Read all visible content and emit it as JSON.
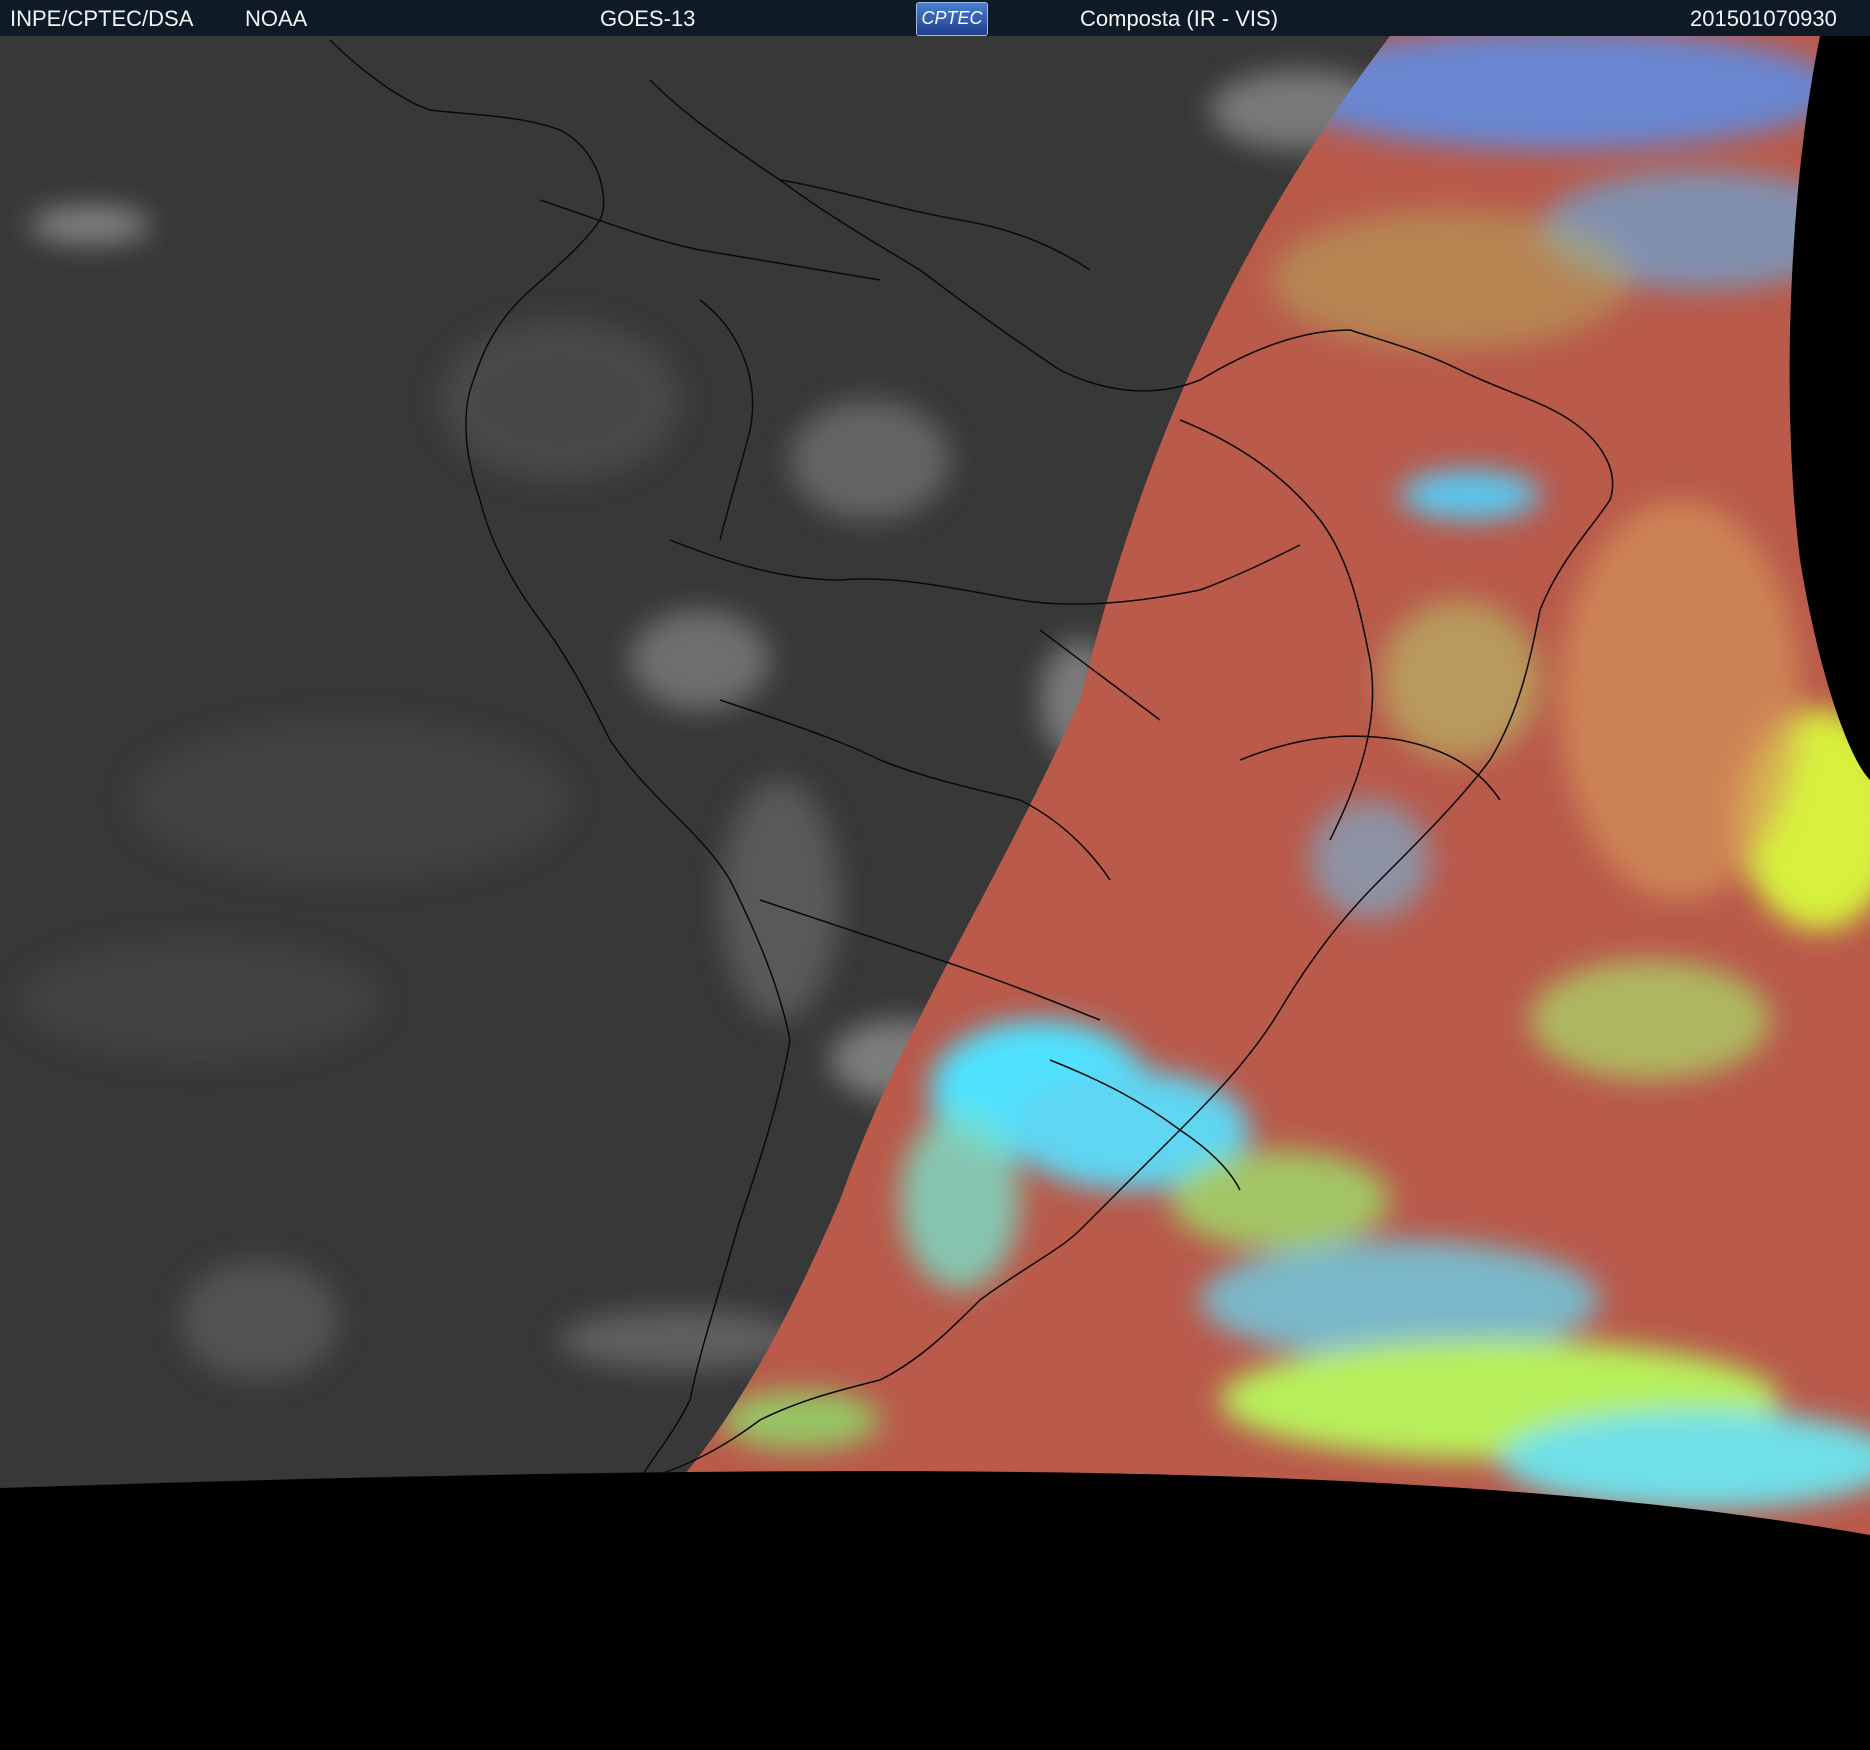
{
  "header": {
    "agency": "INPE/CPTEC/DSA",
    "partner": "NOAA",
    "satellite": "GOES-13",
    "logo_text": "CPTEC",
    "product": "Composta (IR - VIS)",
    "timestamp": "201501070930"
  },
  "colors": {
    "night_gray": "#3a3a3a",
    "day_red": "#b85a4c",
    "cloud_cyan": "#46d6ff",
    "cloud_green": "#a8ef5a",
    "header_bg": "#0e1b26"
  }
}
